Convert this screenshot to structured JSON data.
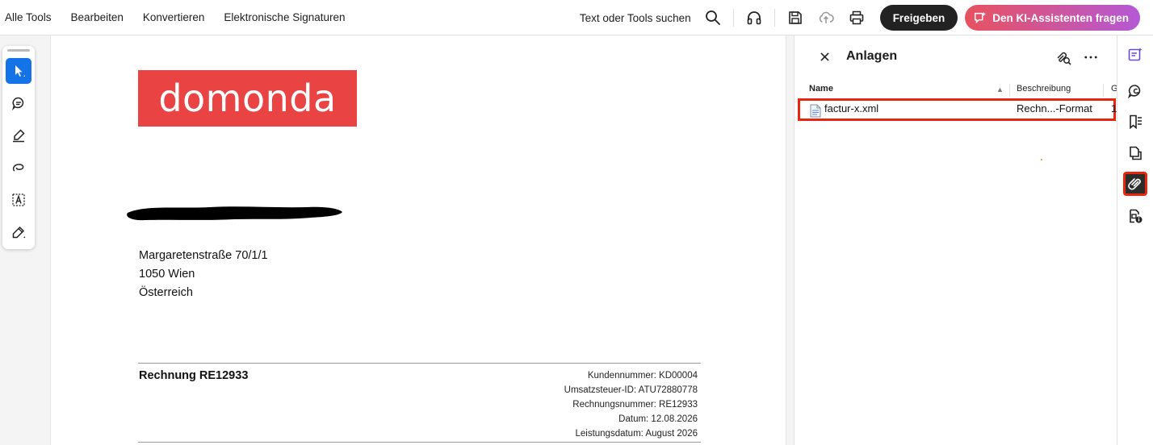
{
  "menu": {
    "items": [
      "Alle Tools",
      "Bearbeiten",
      "Konvertieren",
      "Elektronische Signaturen"
    ]
  },
  "toolbar": {
    "search_label": "Text oder Tools suchen",
    "share_label": "Freigeben",
    "ai_label": "Den KI-Assistenten fragen",
    "icons": [
      "search-icon",
      "headphones-icon",
      "save-icon",
      "cloud-upload-icon",
      "print-icon",
      "ai-assistant-icon"
    ]
  },
  "tools": [
    "select-tool",
    "comment-tool",
    "highlight-tool",
    "draw-tool",
    "text-select-tool",
    "sign-tool"
  ],
  "document": {
    "logo_text": "domonda",
    "address": [
      "Margaretenstraße 70/1/1",
      "1050 Wien",
      "Österreich"
    ],
    "invoice_title": "Rechnung RE12933",
    "meta": [
      "Kundennummer: KD00004",
      "Umsatzsteuer-ID: ATU72880778",
      "Rechnungsnummer: RE12933",
      "Datum: 12.08.2026",
      "Leistungsdatum: August 2026"
    ]
  },
  "attachments_panel": {
    "title": "Anlagen",
    "columns": {
      "name": "Name",
      "description": "Beschreibung",
      "third": "G"
    },
    "rows": [
      {
        "name": "factur-x.xml",
        "description": "Rechn...-Format",
        "extra": "1"
      }
    ]
  },
  "right_rail": [
    "edit-pdf-icon",
    "comments-icon",
    "bookmarks-icon",
    "pages-icon",
    "attachments-icon",
    "protect-icon"
  ],
  "colors": {
    "accent": "#1473e6",
    "highlight": "#e8250f",
    "logo_bg": "#ea4343"
  }
}
